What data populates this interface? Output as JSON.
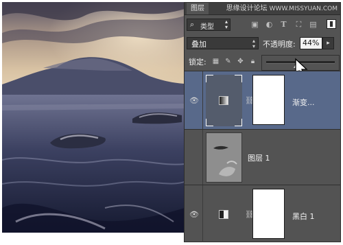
{
  "panel": {
    "tab_label": "图层",
    "watermark": "思缘设计论坛",
    "watermark_url": "WWW.MISSYUAN.COM"
  },
  "filter": {
    "kind_label": "类型",
    "search_icon": "search-icon",
    "icons": [
      "image-filter-icon",
      "adjustment-filter-icon",
      "type-filter-icon",
      "shape-filter-icon",
      "smart-object-filter-icon"
    ]
  },
  "blend": {
    "mode": "叠加",
    "opacity_label": "不透明度:",
    "opacity_value": "44%",
    "opacity_fraction": 0.44
  },
  "lock": {
    "label": "锁定:",
    "icons": [
      "lock-transparent-icon",
      "lock-pixels-icon",
      "lock-position-icon",
      "lock-all-icon"
    ]
  },
  "layers": [
    {
      "name": "渐变...",
      "type": "gradient-map-adjustment",
      "visible": true,
      "selected": true
    },
    {
      "name": "图层 1",
      "type": "pixel",
      "visible": false,
      "selected": false
    },
    {
      "name": "黑白 1",
      "type": "black-white-adjustment",
      "visible": true,
      "selected": false
    }
  ],
  "colors": {
    "panel_bg": "#535353",
    "selected_row": "#58698a"
  }
}
